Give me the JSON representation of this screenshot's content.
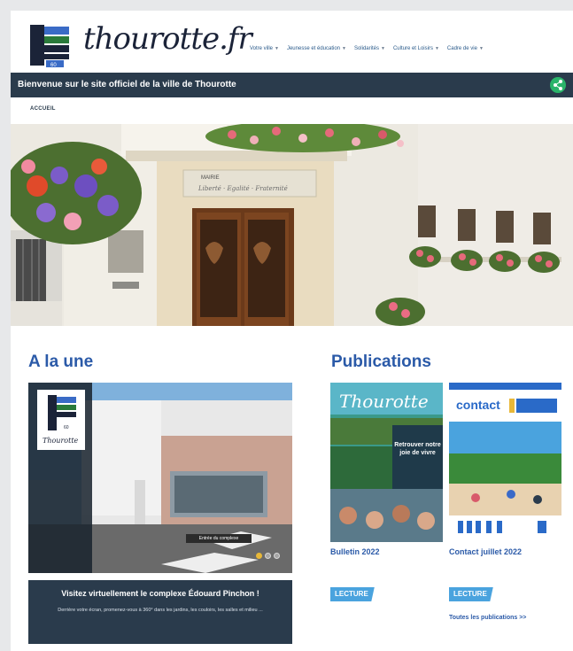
{
  "header": {
    "logo_text": "thourotte.fr",
    "logo_badge": "60"
  },
  "nav": {
    "items": [
      {
        "label": "Votre ville"
      },
      {
        "label": "Jeunesse et éducation"
      },
      {
        "label": "Solidarités"
      },
      {
        "label": "Culture et Loisirs"
      },
      {
        "label": "Cadre de vie"
      }
    ]
  },
  "welcome": {
    "text": "Bienvenue sur le site officiel de la ville de Thourotte",
    "share_icon": "share-icon"
  },
  "breadcrumb": {
    "label": "ACCUEIL"
  },
  "hero": {
    "sign_title": "MAIRIE",
    "sign_motto": "Liberté · Egalité · Fraternité"
  },
  "une": {
    "title": "A la une",
    "tour_label": "Entrée du complexe",
    "tour_logo_badge": "60",
    "tour_logo_text": "Thourotte",
    "headline": "Visitez virtuellement le complexe Édouard Pinchon !",
    "description": "Derrière votre écran, promenez-vous à 360° dans les jardins, les couloirs, les salles et milieu ..."
  },
  "publications": {
    "title": "Publications",
    "items": [
      {
        "label": "Bulletin 2022",
        "cover_title": "Thourotte",
        "cover_tagline": "Retrouver notre joie de vivre",
        "button": "LECTURE"
      },
      {
        "label": "Contact juillet 2022",
        "cover_title": "contact",
        "button": "LECTURE"
      }
    ],
    "all_link": "Toutes les publications >>"
  },
  "colors": {
    "accent_blue": "#2b5aa8",
    "bar_dark": "#2a3b4c",
    "share_green": "#2ab46a",
    "button_blue": "#4aa3de"
  }
}
